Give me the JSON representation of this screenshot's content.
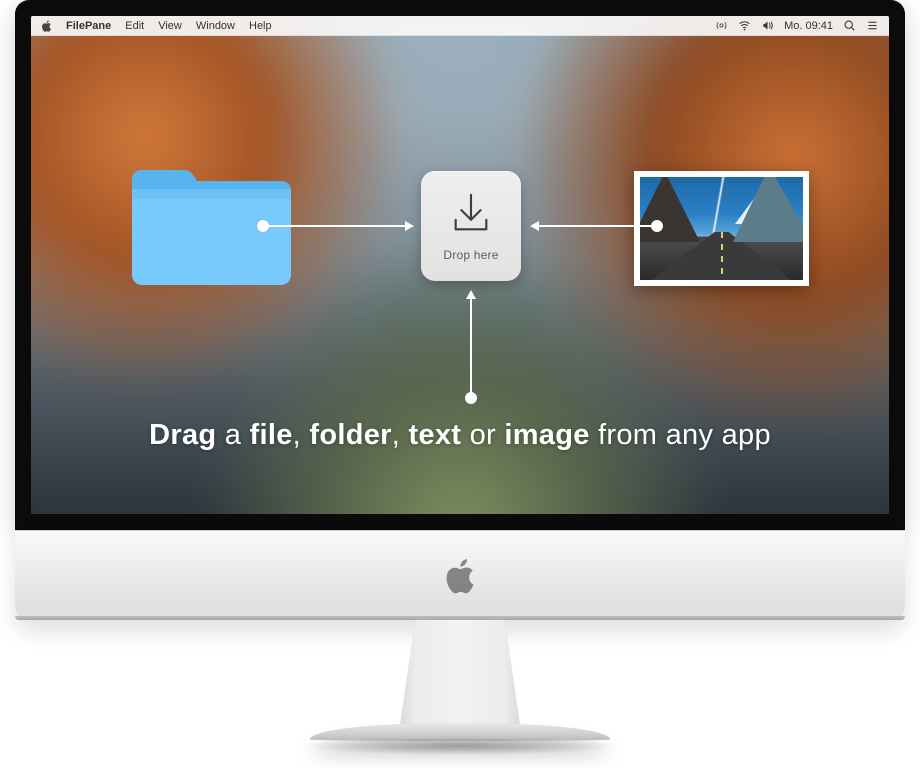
{
  "menubar": {
    "app_name": "FilePane",
    "items": [
      "Edit",
      "View",
      "Window",
      "Help"
    ],
    "clock": "Mo. 09:41"
  },
  "dropzone": {
    "label": "Drop here"
  },
  "caption": {
    "w_drag": "Drag",
    "t_a": " a ",
    "w_file": "file",
    "t_c1": ", ",
    "w_folder": "folder",
    "t_c2": ", ",
    "w_text": "text",
    "t_or": " or ",
    "w_image": "image",
    "t_tail": " from any app"
  }
}
